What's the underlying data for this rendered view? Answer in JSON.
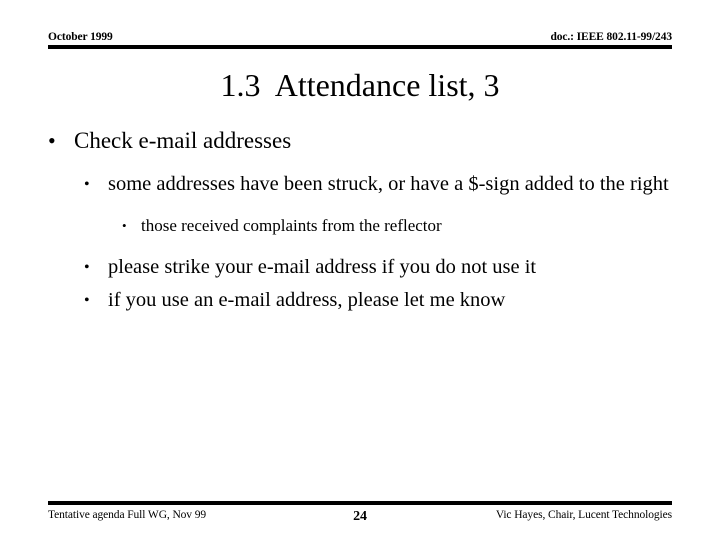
{
  "header": {
    "left": "October 1999",
    "right": "doc.: IEEE 802.11-99/243"
  },
  "title": "1.3  Attendance list, 3",
  "bullets": [
    {
      "level": 1,
      "marker": "•",
      "text": "Check e-mail addresses"
    },
    {
      "level": 2,
      "marker": "•",
      "text": "some addresses have been struck, or have a $-sign added to the right"
    },
    {
      "level": 3,
      "marker": "•",
      "text": "those received complaints from the reflector"
    },
    {
      "level": 2,
      "marker": "•",
      "text": "please strike your e-mail address if you do not use it"
    },
    {
      "level": 2,
      "marker": "•",
      "text": "if you use an e-mail address, please let me know"
    }
  ],
  "footer": {
    "left": "Tentative agenda Full WG, Nov 99",
    "page": "24",
    "right": "Vic Hayes, Chair, Lucent Technologies"
  },
  "colors": {
    "background": "#ffffff",
    "text": "#000000",
    "rule": "#000000"
  }
}
